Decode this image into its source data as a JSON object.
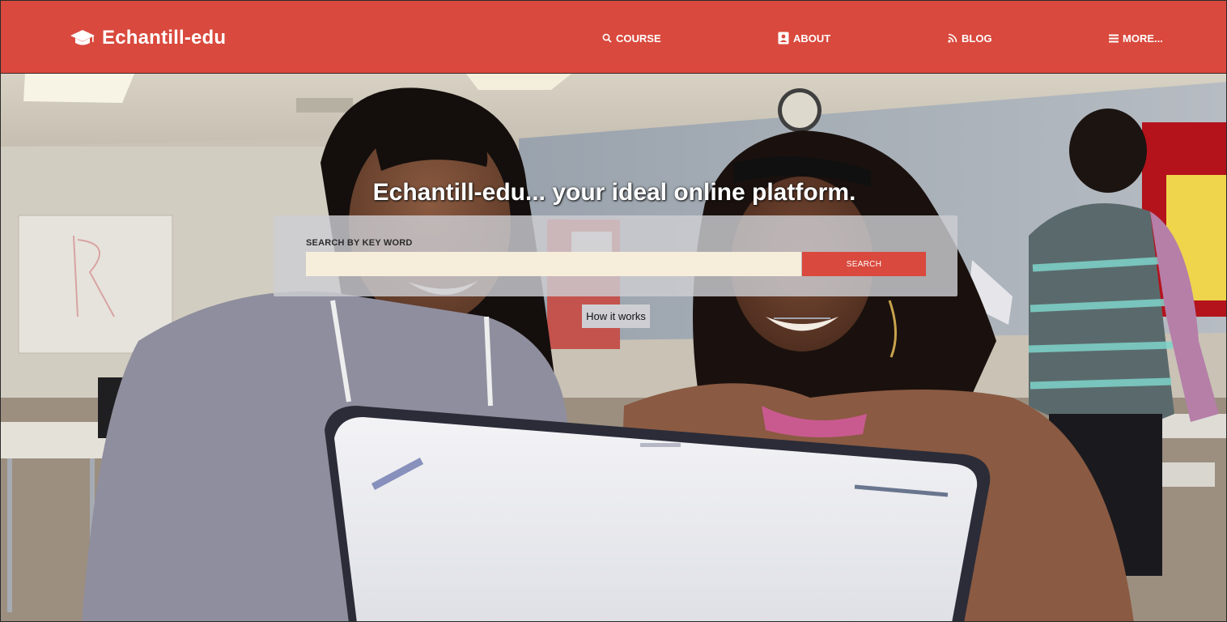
{
  "brand": {
    "name": "Echantill-edu",
    "icon": "graduation-cap-icon"
  },
  "nav": {
    "items": [
      {
        "label": "COURSE",
        "icon": "search-icon"
      },
      {
        "label": "ABOUT",
        "icon": "contact-card-icon"
      },
      {
        "label": "BLOG",
        "icon": "rss-icon"
      },
      {
        "label": "MORE...",
        "icon": "menu-icon"
      }
    ]
  },
  "hero": {
    "headline": "Echantill-edu... your ideal online platform.",
    "image": "classroom-photo-two-students-laptop",
    "search": {
      "label": "SEARCH BY KEY WORD",
      "value": "",
      "placeholder": "",
      "button_label": "SEARCH"
    },
    "how_it_works_label": "How it works"
  },
  "colors": {
    "brand": "#d9493d",
    "header_text": "#ffffff",
    "search_input_bg": "#f6eedb",
    "search_panel_bg": "#cdcdd2"
  }
}
